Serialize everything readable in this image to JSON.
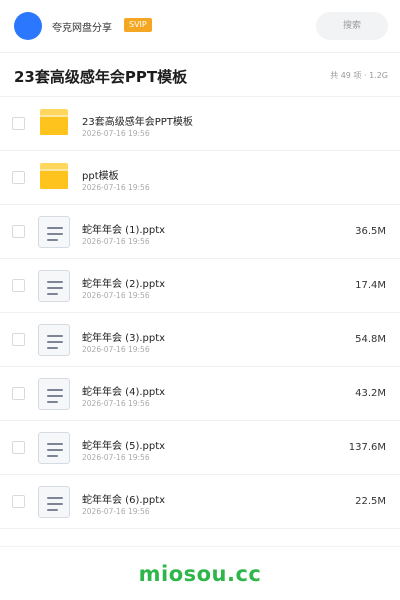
{
  "header": {
    "share_name": "夸克网盘分享",
    "badge": "SVIP",
    "search_label": "搜索",
    "avatar_color": "#2b78ff",
    "badge_color": "#f5a623"
  },
  "folder": {
    "title": "23套高级感年会PPT模板",
    "meta": "共 49 项 · 1.2G"
  },
  "items": [
    {
      "type": "folder",
      "icon": "folder-icon",
      "name": "23套高级感年会PPT模板",
      "date": "2026-07-16 19:56",
      "size": ""
    },
    {
      "type": "folder",
      "icon": "folder-icon",
      "name": "ppt模板",
      "date": "2026-07-16 19:56",
      "size": ""
    },
    {
      "type": "file",
      "icon": "document-icon",
      "name": "蛇年年会 (1).pptx",
      "date": "2026-07-16 19:56",
      "size": "36.5M"
    },
    {
      "type": "file",
      "icon": "document-icon",
      "name": "蛇年年会 (2).pptx",
      "date": "2026-07-16 19:56",
      "size": "17.4M"
    },
    {
      "type": "file",
      "icon": "document-icon",
      "name": "蛇年年会 (3).pptx",
      "date": "2026-07-16 19:56",
      "size": "54.8M"
    },
    {
      "type": "file",
      "icon": "document-icon",
      "name": "蛇年年会 (4).pptx",
      "date": "2026-07-16 19:56",
      "size": "43.2M"
    },
    {
      "type": "file",
      "icon": "document-icon",
      "name": "蛇年年会 (5).pptx",
      "date": "2026-07-16 19:56",
      "size": "137.6M"
    },
    {
      "type": "file",
      "icon": "document-icon",
      "name": "蛇年年会 (6).pptx",
      "date": "2026-07-16 19:56",
      "size": "22.5M"
    }
  ],
  "watermark": "miosou.cc",
  "watermark_color": "#2fb64a"
}
